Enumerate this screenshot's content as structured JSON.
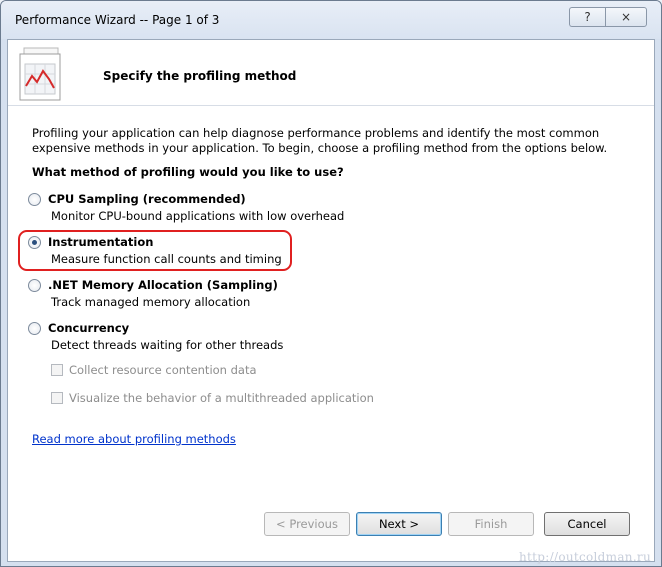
{
  "window": {
    "title": "Performance Wizard -- Page 1 of 3",
    "help_button": "?",
    "close_button": "×"
  },
  "header": {
    "title": "Specify the profiling method",
    "icon": "chart-document-icon"
  },
  "intro_text": "Profiling your application can help diagnose performance problems and identify the most common expensive methods in your application. To begin, choose a profiling method from the options below.",
  "question": "What method of profiling would you like to use?",
  "options": [
    {
      "label": "CPU Sampling (recommended)",
      "description": "Monitor CPU-bound applications with low overhead",
      "checked": false
    },
    {
      "label": "Instrumentation",
      "description": "Measure function call counts and timing",
      "checked": true
    },
    {
      "label": ".NET Memory Allocation (Sampling)",
      "description": "Track managed memory allocation",
      "checked": false
    },
    {
      "label": "Concurrency",
      "description": "Detect threads waiting for other threads",
      "checked": false
    }
  ],
  "sub_options": [
    {
      "label": "Collect resource contention data",
      "checked": false,
      "enabled": false
    },
    {
      "label": "Visualize the behavior of a multithreaded application",
      "checked": false,
      "enabled": false
    }
  ],
  "read_more_link": "Read more about profiling methods",
  "buttons": {
    "previous": "< Previous",
    "next": "Next >",
    "finish": "Finish",
    "cancel": "Cancel"
  },
  "watermark": "http://outcoldman.ru",
  "colors": {
    "highlight": "#e02020",
    "link": "#0033cc"
  }
}
